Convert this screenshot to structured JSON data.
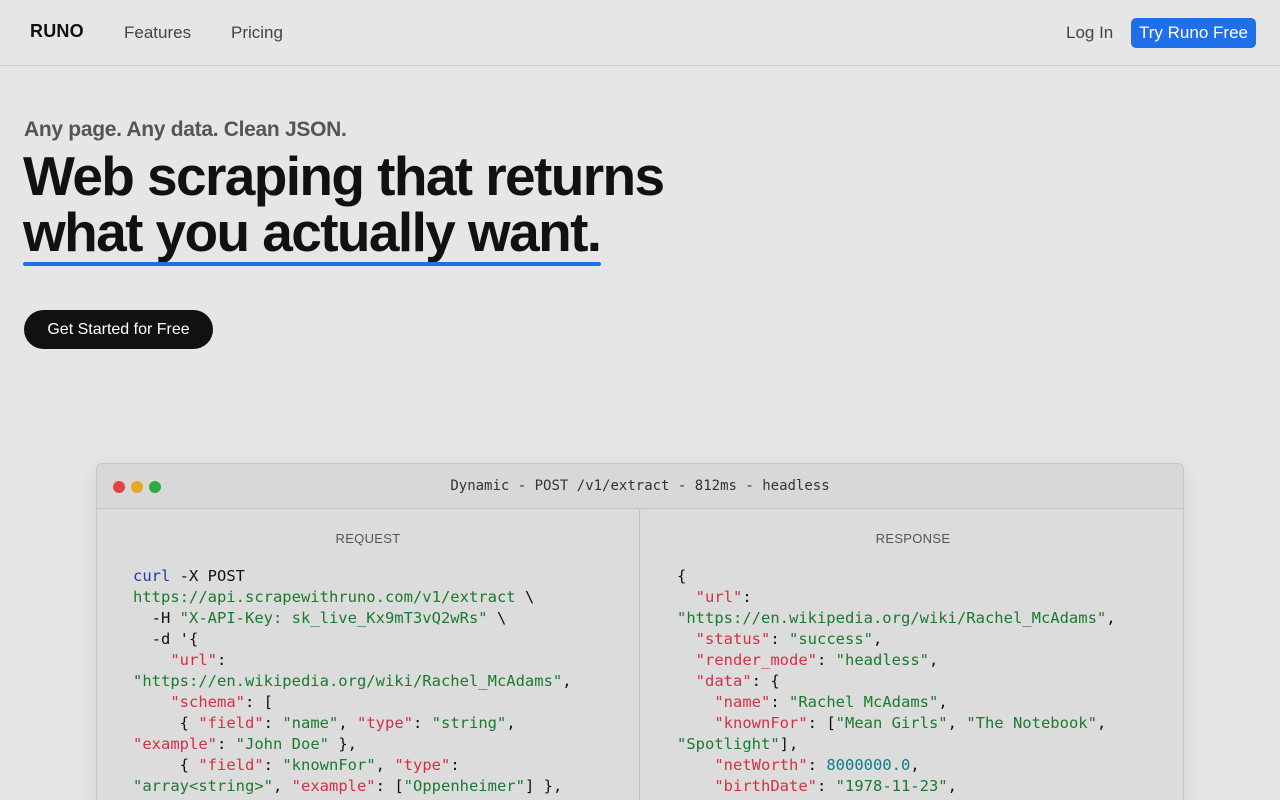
{
  "nav": {
    "logo": "RUNO",
    "features": "Features",
    "pricing": "Pricing",
    "login": "Log In",
    "try": "Try Runo Free"
  },
  "hero": {
    "eyebrow": "Any page. Any data. Clean JSON.",
    "headline_line1": "Web scraping that returns",
    "headline_line2": "what you actually want.",
    "cta": "Get Started for Free"
  },
  "demo": {
    "title": "Dynamic - POST /v1/extract - 812ms - headless",
    "request_label": "REQUEST",
    "response_label": "RESPONSE",
    "request_lines": [
      [
        [
          "cmd",
          "curl"
        ],
        [
          "plain",
          " -X POST"
        ]
      ],
      [
        [
          "str",
          "https://api.scrapewithruno.com/v1/extract"
        ],
        [
          "plain",
          " \\"
        ]
      ],
      [
        [
          "plain",
          "  -H "
        ],
        [
          "str",
          "\"X-API-Key: sk_live_Kx9mT3vQ2wRs\""
        ],
        [
          "plain",
          " \\"
        ]
      ],
      [
        [
          "plain",
          "  -d '{"
        ]
      ],
      [
        [
          "plain",
          "    "
        ],
        [
          "key",
          "\"url\""
        ],
        [
          "plain",
          ":"
        ]
      ],
      [
        [
          "str",
          "\"https://en.wikipedia.org/wiki/Rachel_McAdams\""
        ],
        [
          "plain",
          ","
        ]
      ],
      [
        [
          "plain",
          "    "
        ],
        [
          "key",
          "\"schema\""
        ],
        [
          "plain",
          ": ["
        ]
      ],
      [
        [
          "plain",
          "     { "
        ],
        [
          "key",
          "\"field\""
        ],
        [
          "plain",
          ": "
        ],
        [
          "str",
          "\"name\""
        ],
        [
          "plain",
          ", "
        ],
        [
          "key",
          "\"type\""
        ],
        [
          "plain",
          ": "
        ],
        [
          "str",
          "\"string\""
        ],
        [
          "plain",
          ","
        ]
      ],
      [
        [
          "key",
          "\"example\""
        ],
        [
          "plain",
          ": "
        ],
        [
          "str",
          "\"John Doe\""
        ],
        [
          "plain",
          " },"
        ]
      ],
      [
        [
          "plain",
          "     { "
        ],
        [
          "key",
          "\"field\""
        ],
        [
          "plain",
          ": "
        ],
        [
          "str",
          "\"knownFor\""
        ],
        [
          "plain",
          ", "
        ],
        [
          "key",
          "\"type\""
        ],
        [
          "plain",
          ":"
        ]
      ],
      [
        [
          "str",
          "\"array<string>\""
        ],
        [
          "plain",
          ", "
        ],
        [
          "key",
          "\"example\""
        ],
        [
          "plain",
          ": ["
        ],
        [
          "str",
          "\"Oppenheimer\""
        ],
        [
          "plain",
          "] },"
        ]
      ]
    ],
    "response_lines": [
      [
        [
          "plain",
          "{"
        ]
      ],
      [
        [
          "plain",
          "  "
        ],
        [
          "key",
          "\"url\""
        ],
        [
          "plain",
          ":"
        ]
      ],
      [
        [
          "str",
          "\"https://en.wikipedia.org/wiki/Rachel_McAdams\""
        ],
        [
          "plain",
          ","
        ]
      ],
      [
        [
          "plain",
          "  "
        ],
        [
          "key",
          "\"status\""
        ],
        [
          "plain",
          ": "
        ],
        [
          "str",
          "\"success\""
        ],
        [
          "plain",
          ","
        ]
      ],
      [
        [
          "plain",
          "  "
        ],
        [
          "key",
          "\"render_mode\""
        ],
        [
          "plain",
          ": "
        ],
        [
          "str",
          "\"headless\""
        ],
        [
          "plain",
          ","
        ]
      ],
      [
        [
          "plain",
          "  "
        ],
        [
          "key",
          "\"data\""
        ],
        [
          "plain",
          ": {"
        ]
      ],
      [
        [
          "plain",
          "    "
        ],
        [
          "key",
          "\"name\""
        ],
        [
          "plain",
          ": "
        ],
        [
          "str",
          "\"Rachel McAdams\""
        ],
        [
          "plain",
          ","
        ]
      ],
      [
        [
          "plain",
          "    "
        ],
        [
          "key",
          "\"knownFor\""
        ],
        [
          "plain",
          ": ["
        ],
        [
          "str",
          "\"Mean Girls\""
        ],
        [
          "plain",
          ", "
        ],
        [
          "str",
          "\"The Notebook\""
        ],
        [
          "plain",
          ","
        ]
      ],
      [
        [
          "str",
          "\"Spotlight\""
        ],
        [
          "plain",
          "],"
        ]
      ],
      [
        [
          "plain",
          "    "
        ],
        [
          "key",
          "\"netWorth\""
        ],
        [
          "plain",
          ": "
        ],
        [
          "num",
          "8000000.0"
        ],
        [
          "plain",
          ","
        ]
      ],
      [
        [
          "plain",
          "    "
        ],
        [
          "key",
          "\"birthDate\""
        ],
        [
          "plain",
          ": "
        ],
        [
          "str",
          "\"1978-11-23\""
        ],
        [
          "plain",
          ","
        ]
      ]
    ]
  },
  "colors": {
    "accent": "#1f6feb",
    "key": "#d62f45",
    "string": "#1a7a2e",
    "command": "#1e3fa8",
    "number": "#137a8a"
  }
}
